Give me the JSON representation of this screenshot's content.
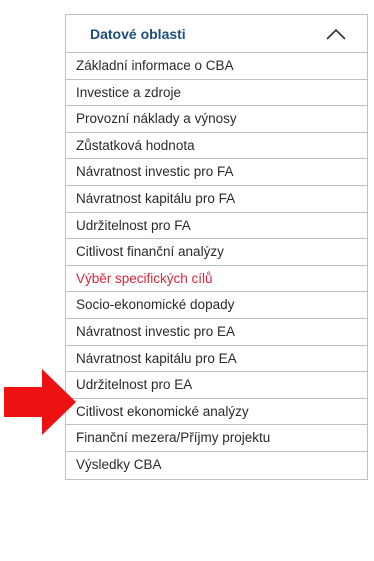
{
  "panel": {
    "title": "Datové oblasti",
    "toggle_icon": "chevron-up-icon"
  },
  "items": [
    {
      "label": "Základní informace o CBA",
      "active": false
    },
    {
      "label": "Investice a zdroje",
      "active": false
    },
    {
      "label": "Provozní náklady a výnosy",
      "active": false
    },
    {
      "label": "Zůstatková hodnota",
      "active": false
    },
    {
      "label": "Návratnost investic pro FA",
      "active": false
    },
    {
      "label": "Návratnost kapitálu pro FA",
      "active": false
    },
    {
      "label": "Udržitelnost pro FA",
      "active": false
    },
    {
      "label": "Citlivost finanční analýzy",
      "active": false
    },
    {
      "label": "Výběr specifických cílů",
      "active": true
    },
    {
      "label": "Socio-ekonomické dopady",
      "active": false
    },
    {
      "label": "Návratnost investic pro EA",
      "active": false
    },
    {
      "label": "Návratnost kapitálu pro EA",
      "active": false
    },
    {
      "label": "Udržitelnost pro EA",
      "active": false
    },
    {
      "label": "Citlivost ekonomické analýzy",
      "active": false
    },
    {
      "label": "Finanční mezera/Příjmy projektu",
      "active": false
    },
    {
      "label": "Výsledky CBA",
      "active": false
    }
  ],
  "annotation": {
    "icon": "red-arrow-icon",
    "color": "#ee1111",
    "points_to": "Návratnost kapitálu pro EA"
  },
  "colors": {
    "title": "#1f4e79",
    "active_item": "#d9263a",
    "border": "#b9c2cc"
  }
}
